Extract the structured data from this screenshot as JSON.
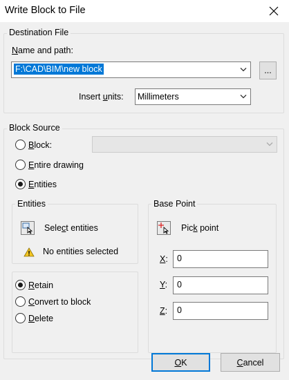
{
  "window": {
    "title": "Write Block to File"
  },
  "destination": {
    "legend": "Destination File",
    "name_label": "Name and path:",
    "path_value": "F:\\CAD\\BIM\\new block",
    "browse_label": "...",
    "units_label": "Insert units:",
    "units_value": "Millimeters"
  },
  "source": {
    "legend": "Block Source",
    "block_label": "Block:",
    "entire_label": "Entire drawing",
    "entities_label": "Entities",
    "selected": "entities"
  },
  "entities_group": {
    "legend": "Entities",
    "select_label": "Select entities",
    "status_text": "No entities selected",
    "retain_label": "Retain",
    "convert_label": "Convert to block",
    "delete_label": "Delete",
    "selected": "retain"
  },
  "base_point": {
    "legend": "Base Point",
    "pick_label": "Pick point",
    "x_label": "X:",
    "x_value": "0",
    "y_label": "Y:",
    "y_value": "0",
    "z_label": "Z:",
    "z_value": "0"
  },
  "buttons": {
    "ok": "OK",
    "cancel": "Cancel"
  },
  "colors": {
    "accent": "#0078d7",
    "face": "#f0f0f0",
    "warning": "#f3c623"
  }
}
